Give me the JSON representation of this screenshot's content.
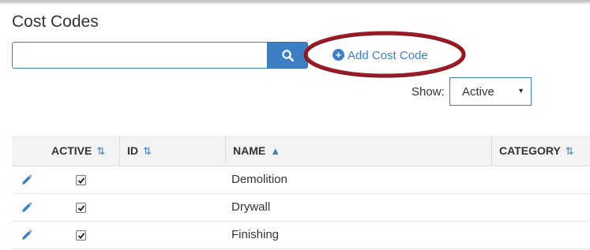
{
  "page": {
    "title": "Cost Codes"
  },
  "search": {
    "value": "",
    "placeholder": ""
  },
  "actions": {
    "add_label": "Add Cost Code"
  },
  "filter": {
    "show_label": "Show:",
    "selected": "Active"
  },
  "table": {
    "headers": {
      "active": "ACTIVE",
      "id": "ID",
      "name": "NAME",
      "category": "CATEGORY"
    },
    "sort": {
      "column": "name",
      "direction": "ascending"
    },
    "rows": [
      {
        "active": true,
        "id": "",
        "name": "Demolition",
        "category": ""
      },
      {
        "active": true,
        "id": "",
        "name": "Drywall",
        "category": ""
      },
      {
        "active": true,
        "id": "",
        "name": "Finishing",
        "category": ""
      }
    ]
  },
  "colors": {
    "accent": "#3d7fc3",
    "highlight": "#9b1c26",
    "header_bg": "#f3f3f3"
  }
}
